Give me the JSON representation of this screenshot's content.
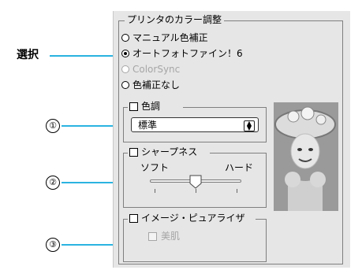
{
  "callouts": {
    "selection_label": "選択",
    "num1": "①",
    "num2": "②",
    "num3": "③"
  },
  "panel": {
    "title": "プリンタのカラー調整",
    "radio_options": [
      {
        "label": "マニュアル色補正",
        "selected": false,
        "disabled": false
      },
      {
        "label": "オートフォトファイン！6",
        "selected": true,
        "disabled": false
      },
      {
        "label": "ColorSync",
        "selected": false,
        "disabled": true
      },
      {
        "label": "色補正なし",
        "selected": false,
        "disabled": false
      }
    ],
    "tone": {
      "label": "色調",
      "value": "標準"
    },
    "sharpness": {
      "label": "シャープネス",
      "left_label": "ソフト",
      "right_label": "ハード",
      "level": 0.5
    },
    "image_purifier": {
      "label": "イメージ・ピュアライザ",
      "beauty_skin_label": "美肌"
    }
  },
  "colors": {
    "callout_line": "#2ab3e0",
    "panel_bg": "#e6e6e6"
  }
}
